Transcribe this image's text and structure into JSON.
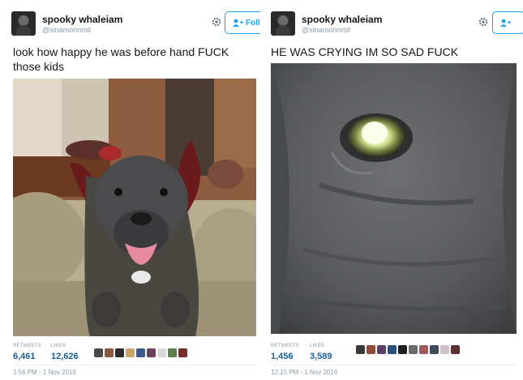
{
  "left_tweet": {
    "name": "spooky whaleiam",
    "handle": "@sinamonnroll",
    "follow_label": "Foll",
    "text_line1": "look how happy he was before hand FUCK",
    "text_line2": "those kids",
    "retweets_label": "RETWEETS",
    "retweets": "6,461",
    "likes_label": "LIKES",
    "likes": "12,626",
    "timestamp": "1:56 PM - 1 Nov 2016",
    "liker_colors": [
      "#4a4a4a",
      "#8b5a3c",
      "#2c2c2c",
      "#c9a46b",
      "#3d5c8a",
      "#6b3e5a",
      "#d8d8d8",
      "#5e7d4e",
      "#7a2c2c"
    ]
  },
  "right_tweet": {
    "name": "spooky whaleiam",
    "handle": "@sinamonnroll",
    "text": "HE WAS CRYING IM SO SAD FUCK",
    "retweets_label": "RETWEETS",
    "retweets": "1,456",
    "likes_label": "LIKES",
    "likes": "3,589",
    "timestamp": "12:15 PM - 1 Nov 2016",
    "liker_colors": [
      "#3a3a3a",
      "#8e4c3b",
      "#5a3f6a",
      "#2b4f7a",
      "#1f1f1f",
      "#6b6b6b",
      "#a05a5a",
      "#404b5a",
      "#d0c0c8",
      "#5a3030"
    ]
  },
  "colors": {
    "follow_blue": "#1da1f2",
    "stat_value": "#1b5e8f",
    "muted": "#8899a6"
  }
}
